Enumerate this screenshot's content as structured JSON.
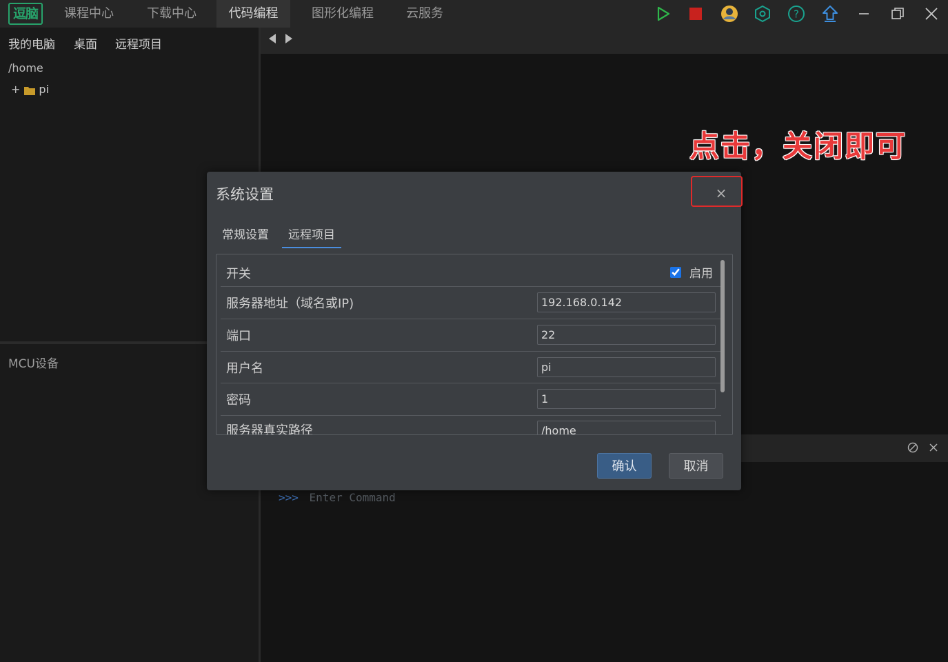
{
  "app": {
    "logo": "逗脑",
    "tabs": [
      "课程中心",
      "下载中心",
      "代码编程",
      "图形化编程",
      "云服务"
    ],
    "active_tab": "代码编程"
  },
  "toolbar_icons": [
    "run-icon",
    "stop-icon",
    "avatar-icon",
    "settings-hex-icon",
    "help-icon",
    "upload-icon",
    "minimize-icon",
    "restore-icon",
    "close-icon"
  ],
  "sidebar": {
    "tabs": [
      "我的电脑",
      "桌面",
      "远程项目"
    ],
    "path": "/home",
    "tree": [
      {
        "expander": "+",
        "name": "pi"
      }
    ],
    "mcu_title": "MCU设备"
  },
  "console": {
    "prompt_symbol": ">>>",
    "placeholder": "Enter Command"
  },
  "annotation": {
    "text": "点击，关闭即可"
  },
  "dialog": {
    "title": "系统设置",
    "close_glyph": "×",
    "tabs": [
      "常规设置",
      "远程项目"
    ],
    "active_tab": "远程项目",
    "switch_label": "开关",
    "enable_label": "启用",
    "enabled": true,
    "fields": [
      {
        "label": "服务器地址（域名或IP)",
        "value": "192.168.0.142"
      },
      {
        "label": "端口",
        "value": "22"
      },
      {
        "label": "用户名",
        "value": "pi"
      },
      {
        "label": "密码",
        "value": "1"
      },
      {
        "label": "服务器真实路径",
        "value": "/home"
      }
    ],
    "confirm": "确认",
    "cancel": "取消"
  },
  "colors": {
    "accent_green": "#27a36b",
    "run_green": "#2fb74b",
    "stop_red": "#c8221e",
    "teal": "#19a38f",
    "tab_underline": "#4a8ee0",
    "confirm_bg": "#395d86",
    "annotation_red": "#e8393a"
  }
}
